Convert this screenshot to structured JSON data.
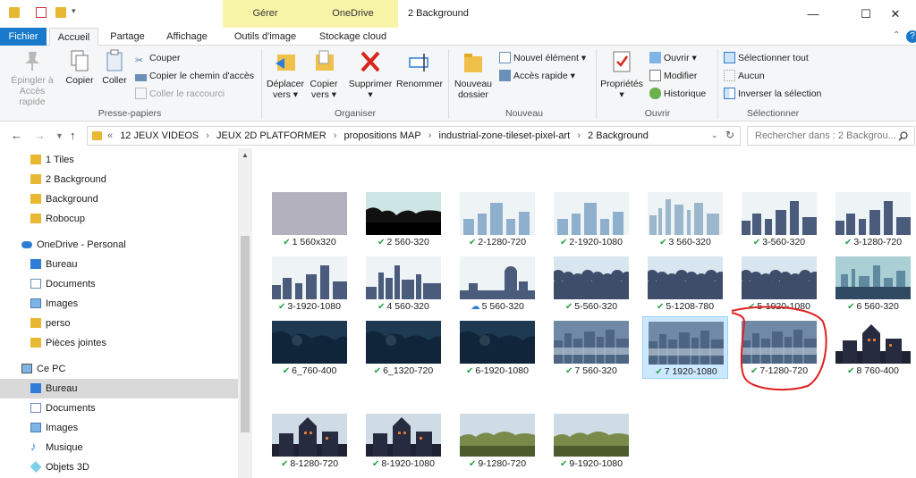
{
  "window": {
    "title": "2 Background",
    "context_headers": [
      "Gérer",
      "OneDrive"
    ],
    "controls": [
      "minimize",
      "maximize",
      "close"
    ]
  },
  "tabs": [
    "Fichier",
    "Accueil",
    "Partage",
    "Affichage",
    "Outils d'image",
    "Stockage cloud"
  ],
  "ribbon": {
    "presse_papiers": {
      "label": "Presse-papiers",
      "epingler": "Épingler à",
      "epingler2": "Accès rapide",
      "copier": "Copier",
      "coller": "Coller",
      "couper": "Couper",
      "copier_chemin": "Copier le chemin d'accès",
      "coller_raccourci": "Coller le raccourci"
    },
    "organiser": {
      "label": "Organiser",
      "deplacer": "Déplacer",
      "deplacer2": "vers ▾",
      "copier": "Copier",
      "copier2": "vers ▾",
      "supprimer": "Supprimer",
      "supprimer2": "▾",
      "renommer": "Renommer"
    },
    "nouveau": {
      "label": "Nouveau",
      "nouveau_dossier": "Nouveau",
      "nouveau_dossier2": "dossier",
      "nouvel_element": "Nouvel élément ▾",
      "acces_rapide": "Accès rapide ▾"
    },
    "ouvrir": {
      "label": "Ouvrir",
      "proprietes": "Propriétés",
      "proprietes2": "▾",
      "ouvrir": "Ouvrir ▾",
      "modifier": "Modifier",
      "historique": "Historique"
    },
    "selectionner": {
      "label": "Sélectionner",
      "tout": "Sélectionner tout",
      "aucun": "Aucun",
      "inverser": "Inverser la sélection"
    }
  },
  "address": {
    "crumbs": [
      "«",
      "12 JEUX VIDEOS",
      "›",
      "JEUX 2D PLATFORMER",
      "›",
      "propositions MAP",
      "›",
      "industrial-zone-tileset-pixel-art",
      "›",
      "2 Background"
    ],
    "search_placeholder": "Rechercher dans : 2 Backgrou..."
  },
  "nav": [
    {
      "label": "1 Tiles",
      "icon": "folder-icon"
    },
    {
      "label": "2 Background",
      "icon": "folder-icon"
    },
    {
      "label": "Background",
      "icon": "folder-icon"
    },
    {
      "label": "Robocup",
      "icon": "folder-icon"
    },
    {
      "label": "OneDrive - Personal",
      "icon": "cloud-icon"
    },
    {
      "label": "Bureau",
      "icon": "desktop-icon"
    },
    {
      "label": "Documents",
      "icon": "documents-icon"
    },
    {
      "label": "Images",
      "icon": "pictures-icon"
    },
    {
      "label": "perso",
      "icon": "folder-icon"
    },
    {
      "label": "Pièces jointes",
      "icon": "folder-icon"
    },
    {
      "label": "Ce PC",
      "icon": "computer-icon"
    },
    {
      "label": "Bureau",
      "icon": "desktop-icon"
    },
    {
      "label": "Documents",
      "icon": "documents-icon"
    },
    {
      "label": "Images",
      "icon": "pictures-icon"
    },
    {
      "label": "Musique",
      "icon": "music-icon"
    },
    {
      "label": "Objets 3D",
      "icon": "3d-objects-icon"
    }
  ],
  "files": [
    {
      "name": "1 560x320",
      "style": "plain",
      "status": "synced"
    },
    {
      "name": "2 560-320",
      "style": "foliage",
      "status": "synced"
    },
    {
      "name": "2-1280-720",
      "style": "blocks-light",
      "status": "synced"
    },
    {
      "name": "2-1920-1080",
      "style": "blocks-light",
      "status": "synced"
    },
    {
      "name": "3 560-320",
      "style": "factory-light",
      "status": "synced"
    },
    {
      "name": "3-560-320",
      "style": "blocks-dark",
      "status": "synced"
    },
    {
      "name": "3-1280-720",
      "style": "blocks-dark",
      "status": "synced"
    },
    {
      "name": "3-1920-1080",
      "style": "blocks-dark",
      "status": "synced"
    },
    {
      "name": "4 560-320",
      "style": "factory-dark",
      "status": "synced"
    },
    {
      "name": "5 560-320",
      "style": "tank",
      "status": "cloud"
    },
    {
      "name": "5-560-320",
      "style": "trees",
      "status": "synced"
    },
    {
      "name": "5-1208-780",
      "style": "trees",
      "status": "synced"
    },
    {
      "name": "5-1920-1080",
      "style": "trees",
      "status": "synced"
    },
    {
      "name": "6 560-320",
      "style": "teal-factory",
      "status": "synced"
    },
    {
      "name": "6_760-400",
      "style": "night",
      "status": "synced"
    },
    {
      "name": "6_1320-720",
      "style": "night",
      "status": "synced"
    },
    {
      "name": "6-1920-1080",
      "style": "night",
      "status": "synced"
    },
    {
      "name": "7 560-320",
      "style": "city-mist",
      "status": "synced"
    },
    {
      "name": "7 1920-1080",
      "style": "city-mist",
      "status": "synced",
      "selected": true
    },
    {
      "name": "7-1280-720",
      "style": "city-mist",
      "status": "synced"
    },
    {
      "name": "8 760-400",
      "style": "house-white",
      "status": "synced"
    },
    {
      "name": "8-1280-720",
      "style": "house-dark",
      "status": "synced"
    },
    {
      "name": "8-1920-1080",
      "style": "house-dark",
      "status": "synced"
    },
    {
      "name": "9-1280-720",
      "style": "olive",
      "status": "synced"
    },
    {
      "name": "9-1920-1080",
      "style": "olive",
      "status": "synced"
    }
  ],
  "colors": {
    "accent": "#1979ca",
    "context_tab": "#f8f4a8",
    "selection": "#cce8ff",
    "sync_check": "#2aa14a",
    "annotation": "#e02020"
  }
}
